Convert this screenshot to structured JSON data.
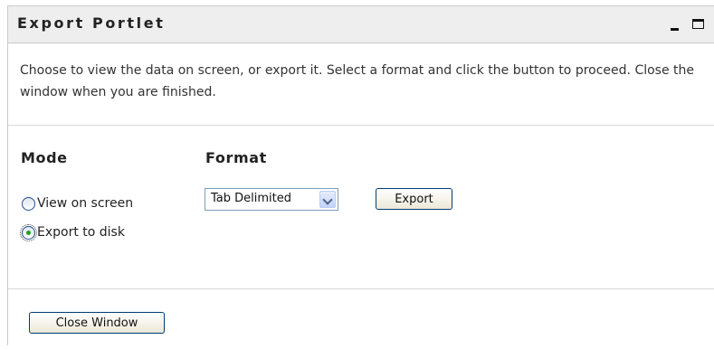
{
  "portlet": {
    "title": "Export Portlet",
    "minimize_icon": "minimize-icon",
    "maximize_icon": "maximize-icon"
  },
  "description": "Choose to view the data on screen, or export it. Select a format and click the button to proceed. Close the window when you are finished.",
  "mode": {
    "heading": "Mode",
    "options": [
      {
        "label": "View on screen",
        "checked": false
      },
      {
        "label": "Export to disk",
        "checked": true
      }
    ]
  },
  "format": {
    "heading": "Format",
    "selected": "Tab Delimited",
    "export_label": "Export"
  },
  "footer": {
    "close_label": "Close Window"
  },
  "colors": {
    "titlebar_bg": "#eeeeee",
    "border": "#c9c9c9",
    "radio_checked_dot": "#21a121"
  }
}
